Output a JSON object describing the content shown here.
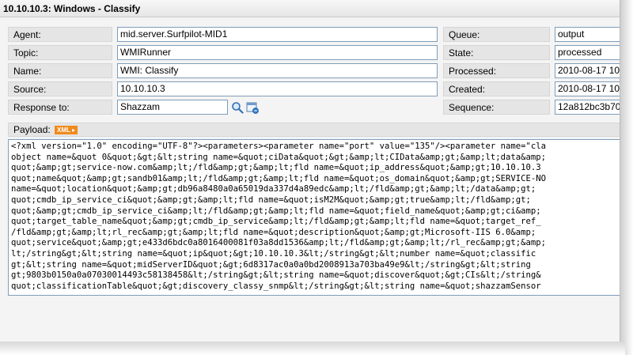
{
  "window": {
    "title": "10.10.10.3: Windows - Classify"
  },
  "form": {
    "agent": {
      "label": "Agent:",
      "value": "mid.server.Surfpilot-MID1"
    },
    "topic": {
      "label": "Topic:",
      "value": "WMIRunner"
    },
    "name": {
      "label": "Name:",
      "value": "WMI: Classify"
    },
    "source": {
      "label": "Source:",
      "value": "10.10.10.3"
    },
    "response_to": {
      "label": "Response to:",
      "value": "Shazzam"
    },
    "queue": {
      "label": "Queue:",
      "value": "output"
    },
    "state": {
      "label": "State:",
      "value": "processed"
    },
    "processed": {
      "label": "Processed:",
      "value": "2010-08-17 10"
    },
    "created": {
      "label": "Created:",
      "value": "2010-08-17 10"
    },
    "sequence": {
      "label": "Sequence:",
      "value": "12a812bc3b70"
    }
  },
  "payload": {
    "label": "Payload:",
    "badge": "XML",
    "lines": [
      "<?xml version=\"1.0\" encoding=\"UTF-8\"?><parameters><parameter name=\"port\" value=\"135\"/><parameter name=\"cla",
      "object name=&quot 0&quot;&gt;&lt;string name=&quot;ciData&quot;&gt;&amp;lt;CIData&amp;gt;&amp;lt;data&amp;",
      "quot;&amp;gt;service-now.com&amp;lt;/fld&amp;gt;&amp;lt;fld name=&quot;ip_address&quot;&amp;gt;10.10.10.3",
      "quot;name&quot;&amp;gt;sandb01&amp;lt;/fld&amp;gt;&amp;lt;fld name=&quot;os_domain&quot;&amp;gt;SERVICE-NO",
      "name=&quot;location&quot;&amp;gt;db96a8480a0a65019da337d4a89edc&amp;lt;/fld&amp;gt;&amp;lt;/data&amp;gt;",
      "quot;cmdb_ip_service_ci&quot;&amp;gt;&amp;lt;fld name=&quot;isM2M&quot;&amp;gt;true&amp;lt;/fld&amp;gt;",
      "quot;&amp;gt;cmdb_ip_service_ci&amp;lt;/fld&amp;gt;&amp;lt;fld name=&quot;field_name&quot;&amp;gt;ci&amp;",
      "quot;target_table_name&quot;&amp;gt;cmdb_ip_service&amp;lt;/fld&amp;gt;&amp;lt;fld name=&quot;target_ref_",
      "/fld&amp;gt;&amp;lt;rl_rec&amp;gt;&amp;lt;fld name=&quot;description&quot;&amp;gt;Microsoft-IIS 6.0&amp;",
      "quot;service&quot;&amp;gt;e433d6bdc0a8016400081f03a8dd1536&amp;lt;/fld&amp;gt;&amp;lt;/rl_rec&amp;gt;&amp;",
      "lt;/string&gt;&lt;string name=&quot;ip&quot;&gt;10.10.10.3&lt;/string&gt;&lt;number name=&quot;classific",
      "gt;&lt;string name=&quot;midServerID&quot;&gt;6d8317ac0a0a0bd2008913a703ba49e9&lt;/string&gt;&lt;string",
      "gt;9803b0150a0a07030014493c58138458&lt;/string&gt;&lt;string name=&quot;discover&quot;&gt;CIs&lt;/string&",
      "quot;classificationTable&quot;&gt;discovery_classy_snmp&lt;/string&gt;&lt;string name=&quot;shazzamSensor"
    ]
  },
  "icons": {
    "lookup": "magnifier-icon",
    "reference": "reference-popup-icon"
  }
}
